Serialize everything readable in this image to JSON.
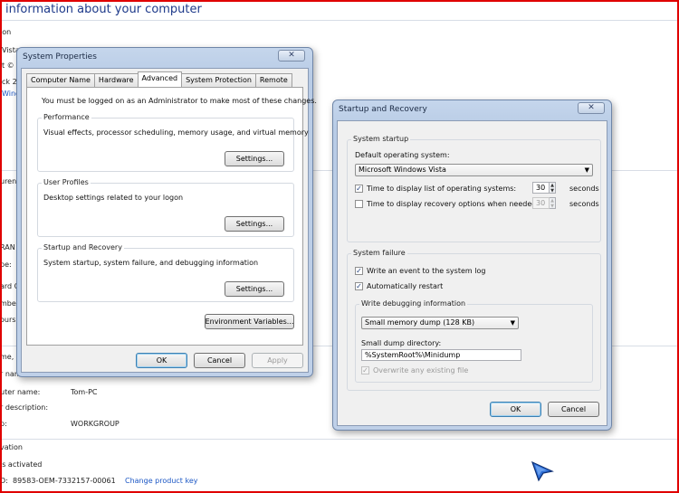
{
  "background": {
    "title": "information about your computer",
    "fragments": [
      "ion",
      "Vista",
      "t © 2",
      "ck 2",
      "Wind",
      "uren",
      "RAN",
      "pe:",
      "ard C",
      "mbe",
      "ours",
      "me, c",
      "r nam",
      "uter name:",
      "r description:",
      "p:",
      "vation",
      "is activated",
      "D:"
    ],
    "computer_name": "Tom-PC",
    "workgroup": "WORKGROUP",
    "product_id": "89583-OEM-7332157-00061",
    "change_product_key": "Change product key"
  },
  "system_properties": {
    "title": "System Properties",
    "tabs": [
      "Computer Name",
      "Hardware",
      "Advanced",
      "System Protection",
      "Remote"
    ],
    "active_tab": "Advanced",
    "admin_note": "You must be logged on as an Administrator to make most of these changes.",
    "performance": {
      "legend": "Performance",
      "description": "Visual effects, processor scheduling, memory usage, and virtual memory",
      "settings_label": "Settings..."
    },
    "user_profiles": {
      "legend": "User Profiles",
      "description": "Desktop settings related to your logon",
      "settings_label": "Settings..."
    },
    "startup_recovery": {
      "legend": "Startup and Recovery",
      "description": "System startup, system failure, and debugging information",
      "settings_label": "Settings..."
    },
    "env_vars_label": "Environment Variables...",
    "ok_label": "OK",
    "cancel_label": "Cancel",
    "apply_label": "Apply"
  },
  "startup_and_recovery": {
    "title": "Startup and Recovery",
    "system_startup": {
      "legend": "System startup",
      "default_os_label": "Default operating system:",
      "default_os_value": "Microsoft Windows Vista",
      "display_list_label": "Time to display list of operating systems:",
      "display_list_checked": true,
      "display_list_seconds": "30",
      "display_recovery_label": "Time to display recovery options when needed:",
      "display_recovery_checked": false,
      "display_recovery_seconds": "30",
      "seconds_label": "seconds"
    },
    "system_failure": {
      "legend": "System failure",
      "write_event_label": "Write an event to the system log",
      "write_event_checked": true,
      "auto_restart_label": "Automatically restart",
      "auto_restart_checked": true,
      "debug_legend": "Write debugging information",
      "debug_value": "Small memory dump (128 KB)",
      "dump_dir_label": "Small dump directory:",
      "dump_dir_value": "%SystemRoot%\\Minidump",
      "overwrite_label": "Overwrite any existing file",
      "overwrite_checked": true
    },
    "ok_label": "OK",
    "cancel_label": "Cancel"
  },
  "icons": {
    "close": "close-icon",
    "dropdown": "chevron-down-icon",
    "check": "check-icon",
    "cursor": "mouse-pointer-icon"
  },
  "colors": {
    "frame": "#e00000",
    "title_blue": "#1e3a8a",
    "link": "#1a56c4",
    "window_chrome": "#bfd0e8"
  }
}
